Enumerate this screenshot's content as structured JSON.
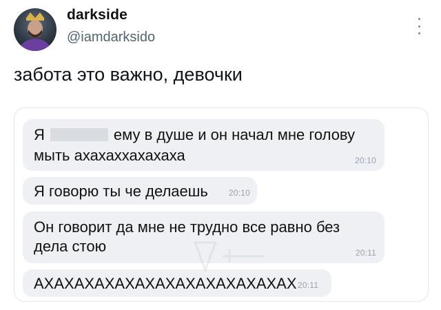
{
  "header": {
    "display_name": "darkside",
    "handle": "@iamdarksido",
    "more_icon": "more-vertical-icon"
  },
  "tweet": {
    "text": "забота это важно, девочки"
  },
  "chat": {
    "messages": [
      {
        "prefix": "Я",
        "rest_line1": "ему в душе и он начал мне голову",
        "line2": "мыть ахахаххахахаха",
        "time": "20:10",
        "has_redaction": true
      },
      {
        "text": "Я говорю ты че делаешь",
        "time": "20:10"
      },
      {
        "line1": "Он говорит да мне не трудно все равно без",
        "line2": "дела стою",
        "time": "20:11"
      },
      {
        "text": "АХАХАХАХАХАХАХАХАХАХАХАХАХ",
        "time": "20:11"
      }
    ]
  }
}
